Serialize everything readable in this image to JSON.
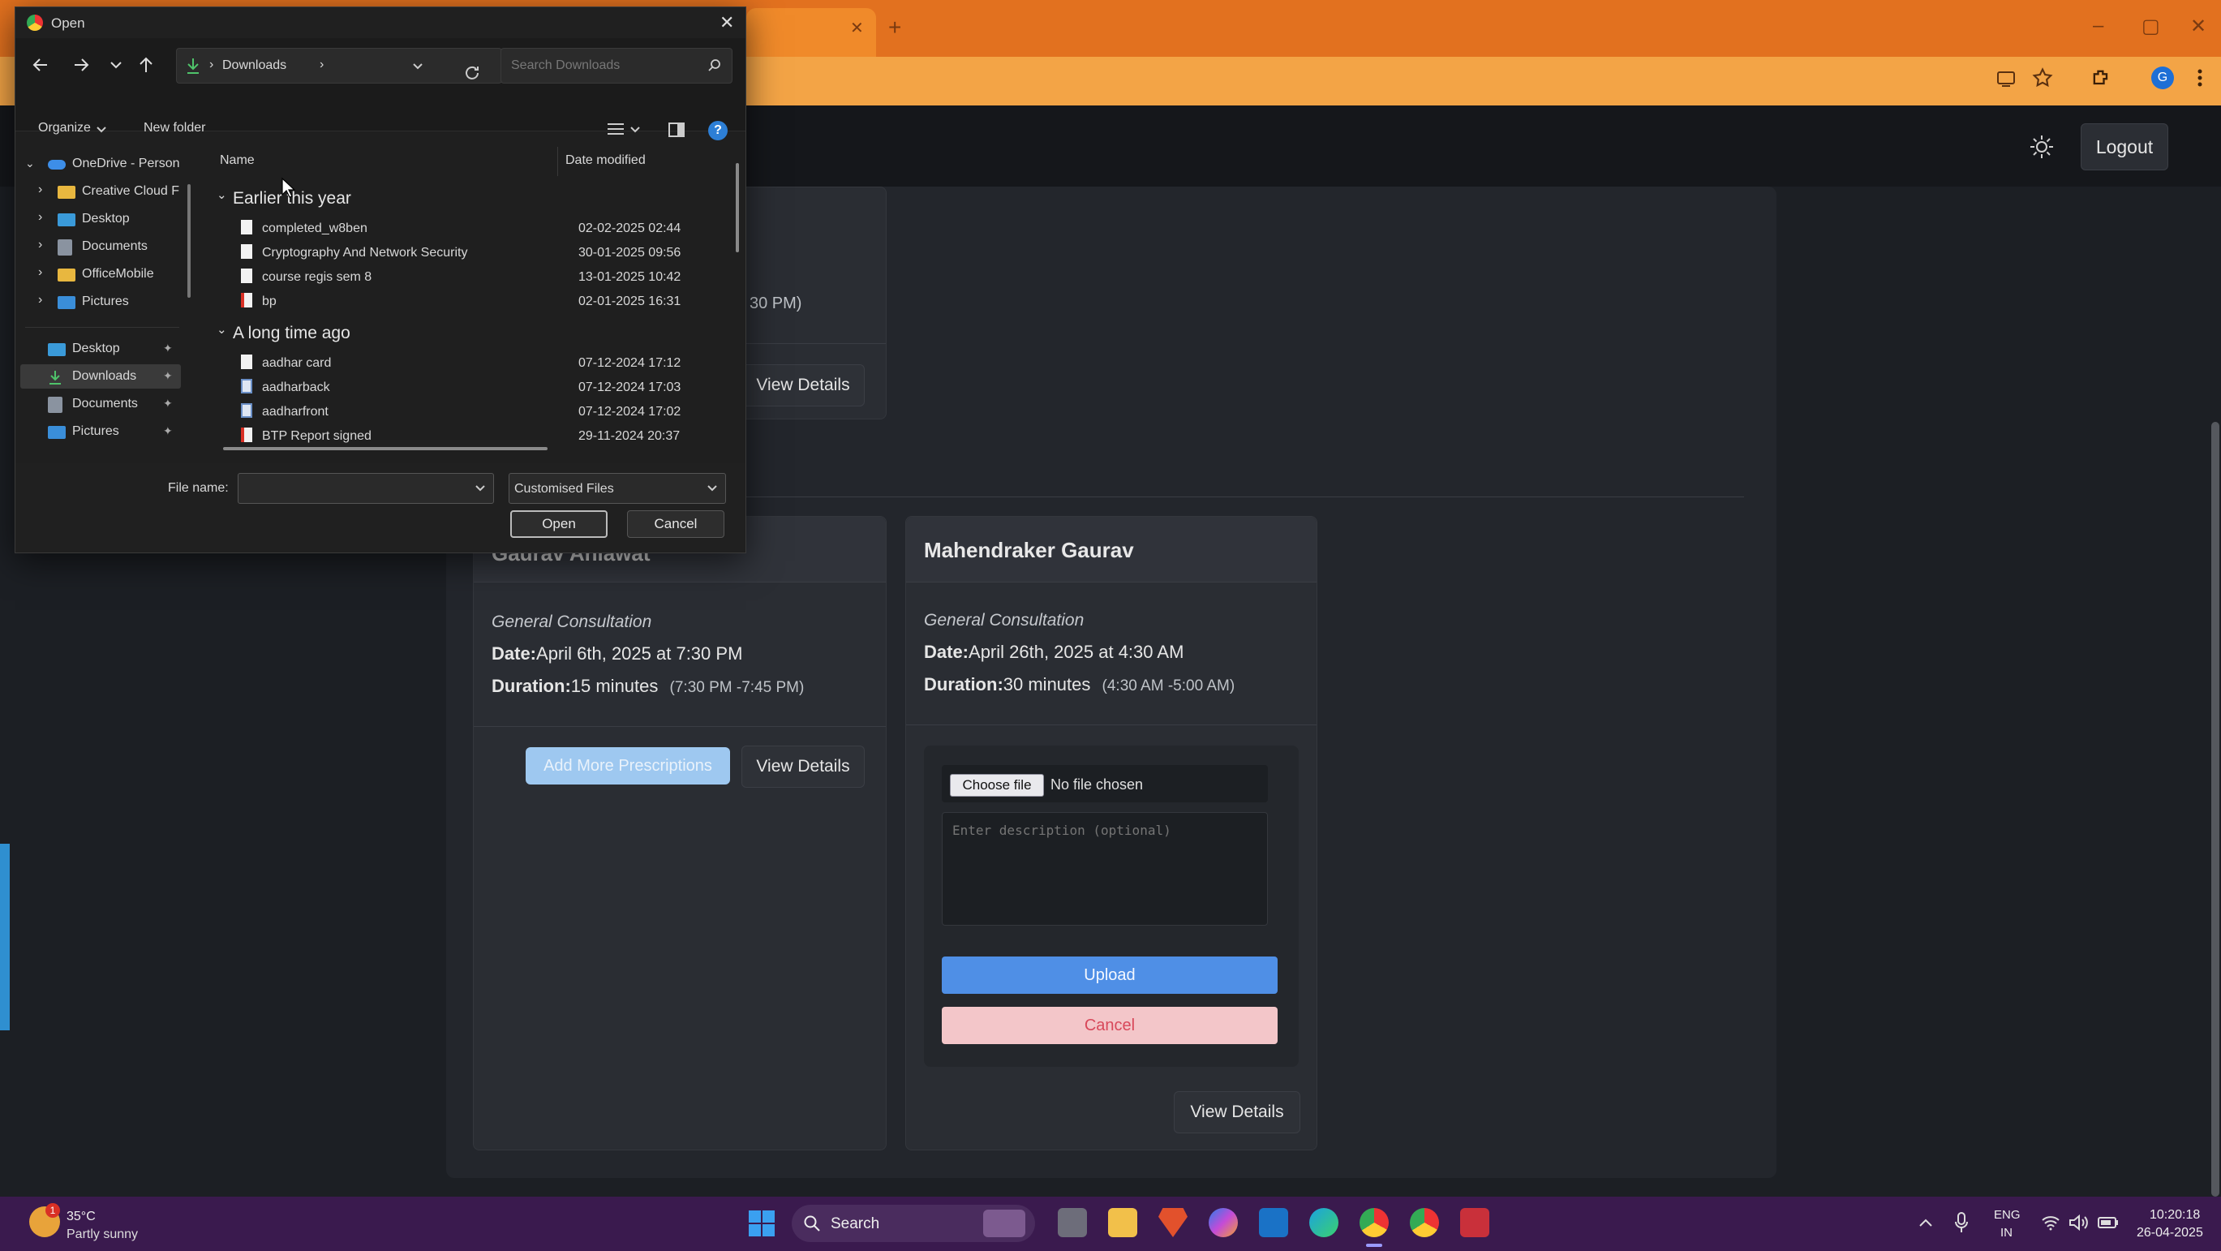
{
  "browser": {
    "tab_close": "✕",
    "new_tab": "+",
    "window_controls": [
      "–",
      "▢",
      "✕"
    ],
    "toolbar_icons": [
      "screen-cast-icon",
      "star-icon",
      "extensions-icon",
      "profile-icon",
      "menu-icon"
    ],
    "profile_initial": "G"
  },
  "app": {
    "logout_label": "Logout",
    "theme_icon": "sun-icon"
  },
  "top_card": {
    "time_fragment": "30 PM)",
    "view_details_label": "View Details"
  },
  "card_left": {
    "doctor_name": "Gaurav Ahlawat",
    "consultation_type": "General Consultation",
    "date_label": "Date:",
    "date_value": "April 6th, 2025 at 7:30 PM",
    "duration_label": "Duration:",
    "duration_value": "15 minutes",
    "duration_range": "(7:30 PM -7:45 PM)",
    "add_prescriptions_label": "Add More Prescriptions",
    "view_details_label": "View Details"
  },
  "card_right": {
    "doctor_name": "Mahendraker Gaurav",
    "consultation_type": "General Consultation",
    "date_label": "Date:",
    "date_value": "April 26th, 2025 at 4:30 AM",
    "duration_label": "Duration:",
    "duration_value": "30 minutes",
    "duration_range": "(4:30 AM -5:00 AM)",
    "choose_file_label": "Choose file",
    "no_file_text": "No file chosen",
    "description_placeholder": "Enter description (optional)",
    "upload_label": "Upload",
    "cancel_label": "Cancel",
    "view_details_label": "View Details"
  },
  "dialog": {
    "title": "Open",
    "path": "Downloads",
    "search_placeholder": "Search Downloads",
    "organize_label": "Organize",
    "new_folder_label": "New folder",
    "col_name": "Name",
    "col_date": "Date modified",
    "nav_tree": [
      "OneDrive - Person",
      "Creative Cloud F",
      "Desktop",
      "Documents",
      "OfficeMobile",
      "Pictures"
    ],
    "quick_access": [
      "Desktop",
      "Downloads",
      "Documents",
      "Pictures"
    ],
    "groups": [
      {
        "label": "Earlier this year",
        "files": [
          {
            "name": "completed_w8ben",
            "date": "02-02-2025 02:44"
          },
          {
            "name": "Cryptography And Network Security",
            "date": "30-01-2025 09:56"
          },
          {
            "name": "course regis sem 8",
            "date": "13-01-2025 10:42"
          },
          {
            "name": "bp",
            "date": "02-01-2025 16:31"
          }
        ]
      },
      {
        "label": "A long time ago",
        "files": [
          {
            "name": "aadhar card",
            "date": "07-12-2024 17:12"
          },
          {
            "name": "aadharback",
            "date": "07-12-2024 17:03"
          },
          {
            "name": "aadharfront",
            "date": "07-12-2024 17:02"
          },
          {
            "name": "BTP Report signed",
            "date": "29-11-2024 20:37"
          }
        ]
      }
    ],
    "file_name_label": "File name:",
    "file_type": "Customised Files",
    "open_label": "Open",
    "cancel_label": "Cancel"
  },
  "taskbar": {
    "temperature": "35°C",
    "weather": "Partly sunny",
    "weather_badge": "1",
    "search_label": "Search",
    "lang_top": "ENG",
    "lang_bottom": "IN",
    "time": "10:20:18",
    "date": "26-04-2025"
  }
}
